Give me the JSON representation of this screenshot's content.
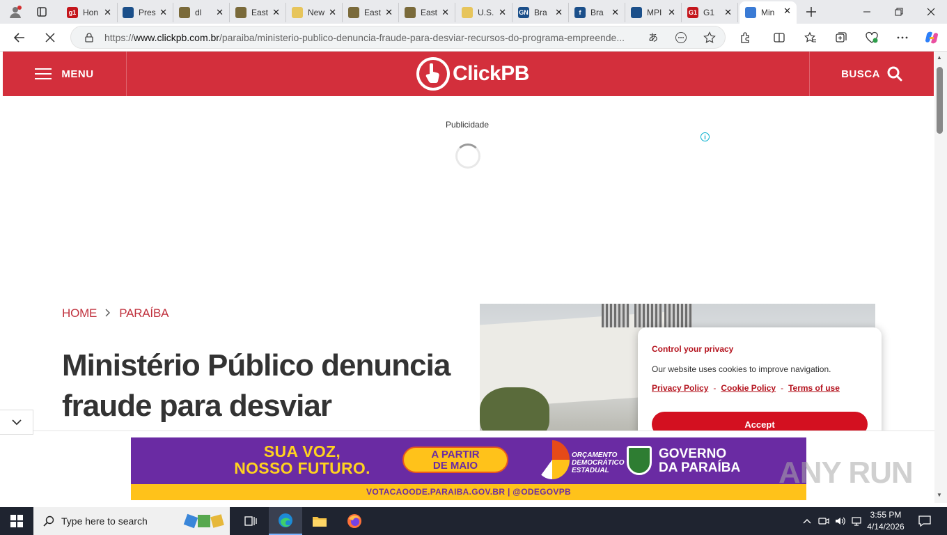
{
  "tabs": [
    {
      "label": "Hon",
      "fav_color": "#c4161c",
      "fav_text": "g1"
    },
    {
      "label": "Pres",
      "fav_color": "#1b4f8a",
      "fav_text": ""
    },
    {
      "label": "dl",
      "fav_color": "#7a6a3a",
      "fav_text": ""
    },
    {
      "label": "East",
      "fav_color": "#7a6a3a",
      "fav_text": ""
    },
    {
      "label": "New",
      "fav_color": "#e7c55b",
      "fav_text": ""
    },
    {
      "label": "East",
      "fav_color": "#7a6a3a",
      "fav_text": ""
    },
    {
      "label": "East",
      "fav_color": "#7a6a3a",
      "fav_text": ""
    },
    {
      "label": "U.S.",
      "fav_color": "#e7c55b",
      "fav_text": ""
    },
    {
      "label": "Bra",
      "fav_color": "#1b4f8a",
      "fav_text": "GN"
    },
    {
      "label": "Bra",
      "fav_color": "#1b4f8a",
      "fav_text": "f"
    },
    {
      "label": "MPI",
      "fav_color": "#1b4f8a",
      "fav_text": ""
    },
    {
      "label": "G1",
      "fav_color": "#c4161c",
      "fav_text": "G1"
    },
    {
      "label": "Min",
      "fav_color": "#3a7bd5",
      "fav_text": ""
    }
  ],
  "browser": {
    "url_prefix": "https://",
    "url_host": "www.clickpb.com.br",
    "url_path": "/paraiba/ministerio-publico-denuncia-fraude-para-desviar-recursos-do-programa-empreende..."
  },
  "site": {
    "menu_label": "MENU",
    "logo_text": "ClickPB",
    "search_label": "BUSCA",
    "brand_color": "#d32f3c"
  },
  "ad": {
    "label": "Publicidade"
  },
  "article": {
    "crumb_home": "HOME",
    "crumb_section": "PARAÍBA",
    "headline": "Ministério Público denuncia fraude para desviar"
  },
  "cookie": {
    "title": "Control your privacy",
    "message": "Our website uses cookies to improve navigation.",
    "link_privacy": "Privacy Policy",
    "link_cookie": "Cookie Policy",
    "link_terms": "Terms of use",
    "accept": "Accept"
  },
  "banner": {
    "slogan_line1": "SUA VOZ,",
    "slogan_line2": "NOSSO FUTURO.",
    "pill_line1": "A PARTIR",
    "pill_line2": "DE MAIO",
    "ode_text": "ORÇAMENTO DEMOCRÁTICO ESTADUAL",
    "gov_line1": "GOVERNO",
    "gov_line2": "DA PARAÍBA",
    "footer": "VOTACAOODE.PARAIBA.GOV.BR | @ODEGOVPB"
  },
  "watermark": "ANY RUN",
  "taskbar": {
    "search_placeholder": "Type here to search",
    "time": "3:55 PM",
    "date": "4/14/2026"
  }
}
